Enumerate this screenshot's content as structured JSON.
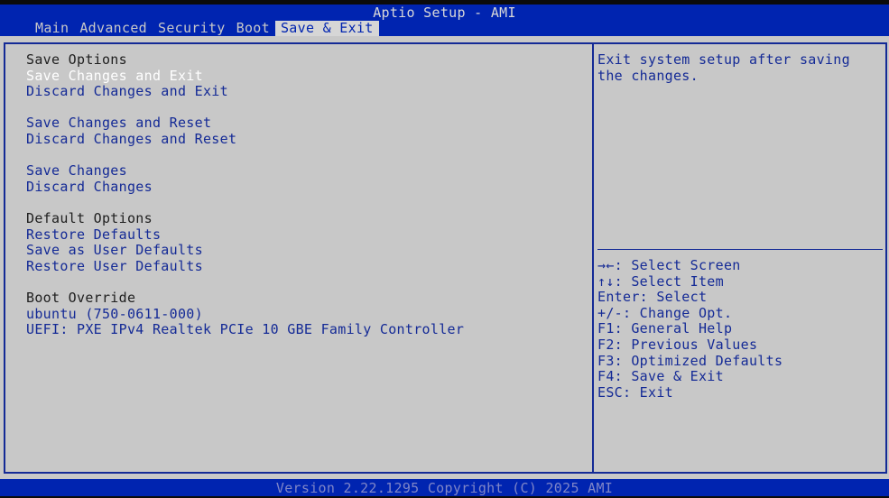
{
  "header": {
    "title": "Aptio Setup - AMI",
    "tabs": [
      "Main",
      "Advanced",
      "Security",
      "Boot",
      "Save & Exit"
    ],
    "active_tab": "Save & Exit"
  },
  "menu": {
    "save_options_header": "Save Options",
    "save_changes_and_exit": "Save Changes and Exit",
    "discard_changes_and_exit": "Discard Changes and Exit",
    "save_changes_and_reset": "Save Changes and Reset",
    "discard_changes_and_reset": "Discard Changes and Reset",
    "save_changes": "Save Changes",
    "discard_changes": "Discard Changes",
    "default_options_header": "Default Options",
    "restore_defaults": "Restore Defaults",
    "save_as_user_defaults": "Save as User Defaults",
    "restore_user_defaults": "Restore User Defaults",
    "boot_override_header": "Boot Override",
    "boot_ubuntu": "ubuntu (750-0611-000)",
    "boot_uefi_pxe": "UEFI: PXE IPv4 Realtek PCIe 10 GBE Family Controller"
  },
  "help": {
    "text": "Exit system setup after saving the changes."
  },
  "keys": [
    "→←: Select Screen",
    "↑↓: Select Item",
    "Enter: Select",
    "+/-: Change Opt.",
    "F1: General Help",
    "F2: Previous Values",
    "F3: Optimized Defaults",
    "F4: Save & Exit",
    "ESC: Exit"
  ],
  "footer": {
    "version": "Version 2.22.1295 Copyright (C) 2025 AMI"
  },
  "colors": {
    "bar_blue": "#0024b0",
    "panel_gray": "#c8c8c8",
    "item_blue": "#142a96",
    "selected_white": "#ffffff"
  }
}
